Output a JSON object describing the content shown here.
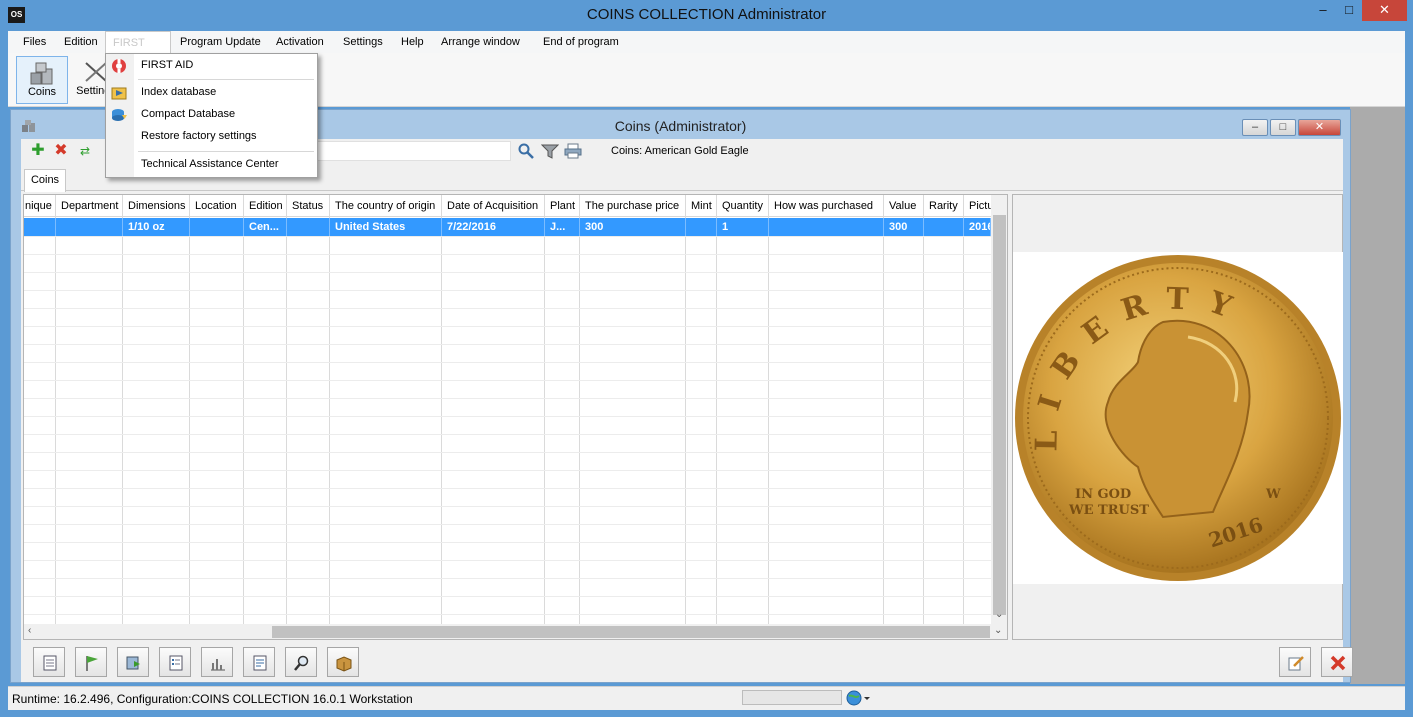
{
  "window": {
    "app_icon": "OS",
    "title": "COINS COLLECTION  Administrator",
    "minimize": "–",
    "maximize": "□",
    "close": "✕"
  },
  "menu": {
    "items": [
      {
        "label": "Files"
      },
      {
        "label": "Edition"
      },
      {
        "label": "FIRST AID"
      },
      {
        "label": "Program Update"
      },
      {
        "label": "Activation"
      },
      {
        "label": "Settings"
      },
      {
        "label": "Help"
      },
      {
        "label": "Arrange window"
      },
      {
        "label": "End of program"
      }
    ]
  },
  "toolbar": {
    "coins_label": "Coins",
    "settings_label": "Settings"
  },
  "dropdown": {
    "items": [
      {
        "label": "FIRST AID",
        "icon": "lifebuoy-icon"
      },
      {
        "label": "Index database",
        "icon": "index-icon"
      },
      {
        "label": "Compact Database",
        "icon": "compact-icon"
      },
      {
        "label": "Restore factory settings",
        "icon": ""
      },
      {
        "label": "Technical Assistance Center",
        "icon": ""
      }
    ]
  },
  "child_window": {
    "title": "Coins (Administrator)",
    "record_label": "Coins: American Gold Eagle",
    "tab": "Coins"
  },
  "grid": {
    "headers": [
      "nique",
      "Department",
      "Dimensions",
      "Location",
      "Edition",
      "Status",
      "The country of origin",
      "Date of Acquisition",
      "Plant",
      "The purchase price",
      "Mint",
      "Quantity",
      "How was purchased",
      "Value",
      "Rarity",
      "Pictu"
    ],
    "row": [
      "",
      "",
      "1/10 oz",
      "",
      "Cen...",
      "",
      "United States",
      "7/22/2016",
      "J...",
      "300",
      "",
      "1",
      "",
      "300",
      "",
      "2016"
    ]
  },
  "coin_image": {
    "legend": "LIBERTY",
    "motto_1": "IN GOD",
    "motto_2": "WE TRUST",
    "year": "2016",
    "mint_mark": "W"
  },
  "statusbar": {
    "text": "Runtime: 16.2.496, Configuration:COINS COLLECTION 16.0.1 Workstation"
  },
  "colors": {
    "title_bar": "#5b9ad4",
    "selection": "#3399ff",
    "close_button": "#c7463a",
    "coin_gold": "#d9a441"
  }
}
